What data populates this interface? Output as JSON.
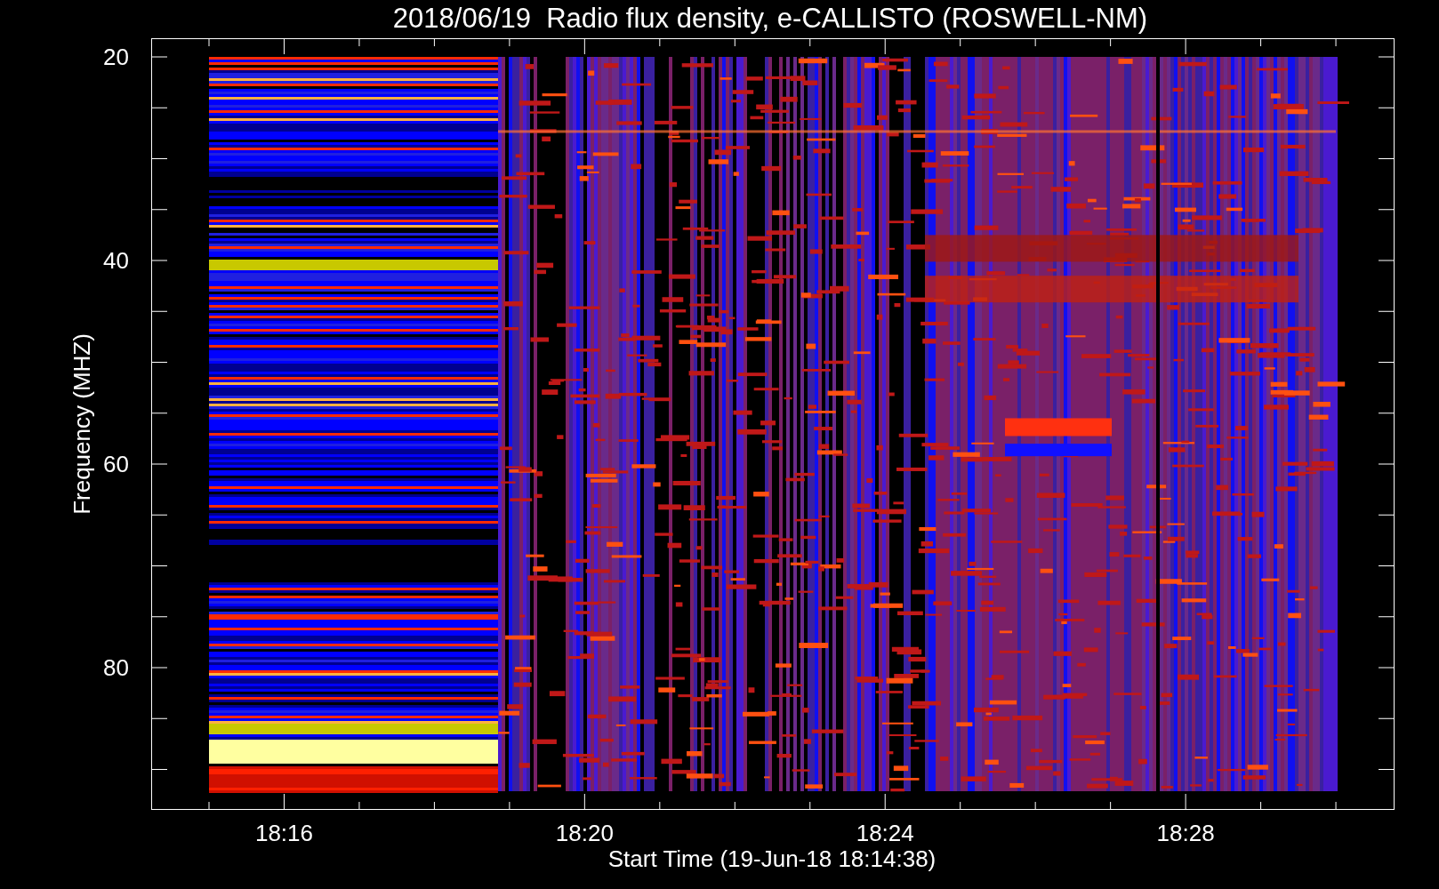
{
  "chart": {
    "title": "2018/06/19  Radio flux density, e-CALLISTO (ROSWELL-NM)",
    "xlabel": "Start Time (19-Jun-18 18:14:38)",
    "ylabel": "Frequency (MHZ)",
    "xticks": [
      "18:16",
      "18:20",
      "18:24",
      "18:28"
    ],
    "yticks": [
      "20",
      "40",
      "60",
      "80"
    ]
  }
}
